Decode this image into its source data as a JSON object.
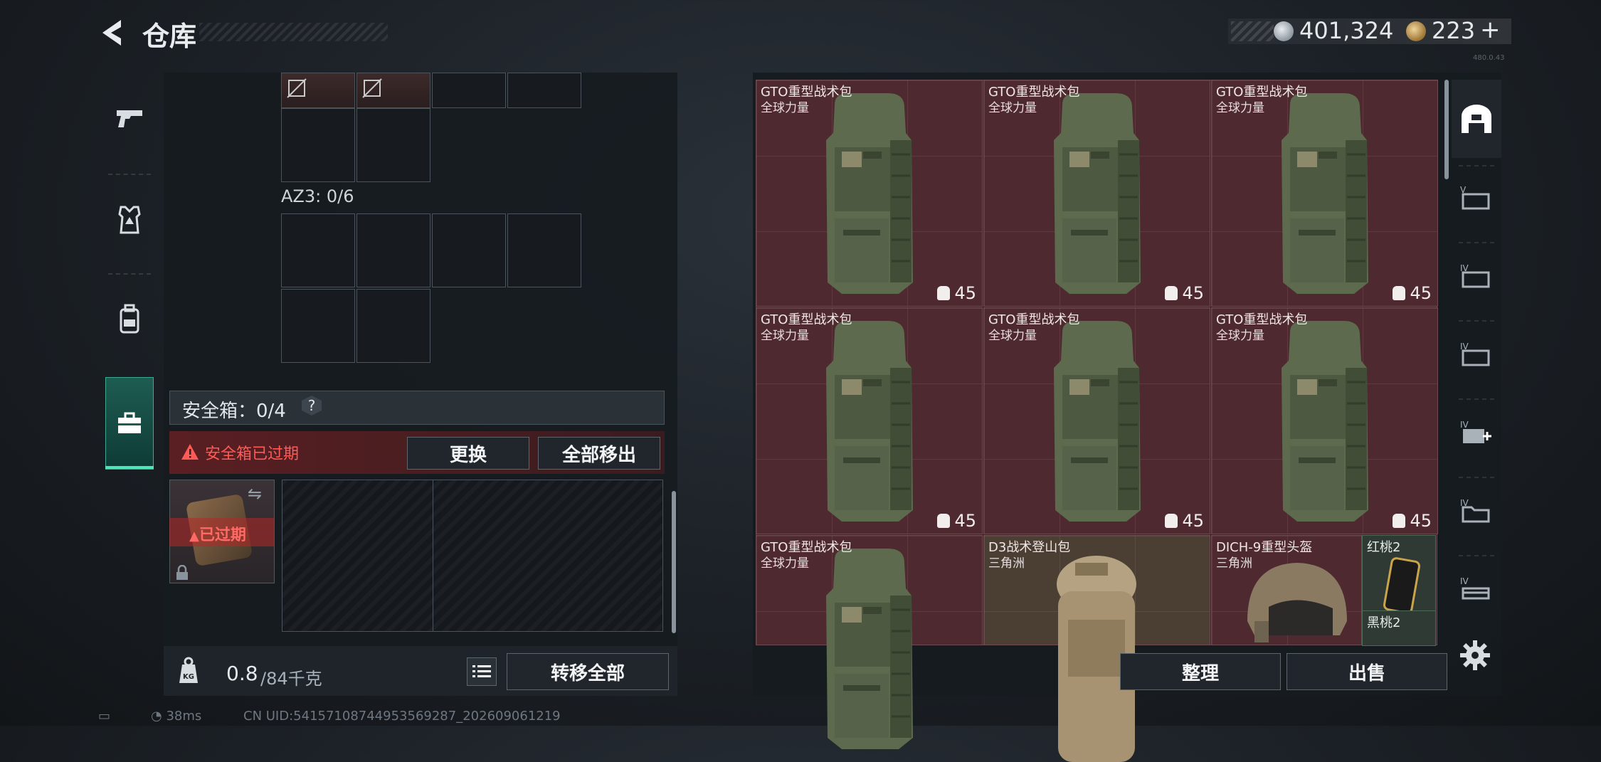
{
  "header": {
    "title": "仓库",
    "currency_silver": "401,324",
    "currency_gold": "223",
    "currency_plus": "+"
  },
  "version_tag": "480.0.43",
  "left_nav": {
    "tabs": [
      {
        "name": "weapons",
        "icon": "pistol-icon"
      },
      {
        "name": "armor",
        "icon": "vest-icon"
      },
      {
        "name": "backpack",
        "icon": "backpack-icon"
      },
      {
        "name": "safebox",
        "icon": "toolbox-icon",
        "active": true
      }
    ]
  },
  "container": {
    "az3_label": "AZ3: 0/6"
  },
  "safebox": {
    "label": "安全箱：0/4",
    "help": "?",
    "expired_warning": "安全箱已过期",
    "replace_button": "更换",
    "move_all_button": "全部移出",
    "item_expired": "已过期"
  },
  "weight": {
    "current": "0.8",
    "total": "/84千克"
  },
  "transfer_all_button": "转移全部",
  "items": [
    {
      "name": "GTO重型战术包",
      "brand": "全球力量",
      "capacity": "45"
    },
    {
      "name": "GTO重型战术包",
      "brand": "全球力量",
      "capacity": "45"
    },
    {
      "name": "GTO重型战术包",
      "brand": "全球力量",
      "capacity": "45"
    },
    {
      "name": "GTO重型战术包",
      "brand": "全球力量",
      "capacity": "45"
    },
    {
      "name": "GTO重型战术包",
      "brand": "全球力量",
      "capacity": "45"
    },
    {
      "name": "GTO重型战术包",
      "brand": "全球力量",
      "capacity": "45"
    },
    {
      "name": "GTO重型战术包",
      "brand": "全球力量",
      "capacity": ""
    },
    {
      "name": "D3战术登山包",
      "brand": "三角洲",
      "capacity": ""
    },
    {
      "name": "DICH-9重型头盔",
      "brand": "三角洲",
      "capacity": ""
    }
  ],
  "cards": {
    "red_peach": "红桃2",
    "black_peach": "黑桃2"
  },
  "right_buttons": {
    "sort": "整理",
    "sell": "出售"
  },
  "status": {
    "ping": "38ms",
    "uid": "CN UID:54157108744953569287_202609061219"
  },
  "colors": {
    "accent_green": "#4ee6b9",
    "warning_red": "#ff5a56",
    "item_red_bg": "#4e2a30"
  }
}
